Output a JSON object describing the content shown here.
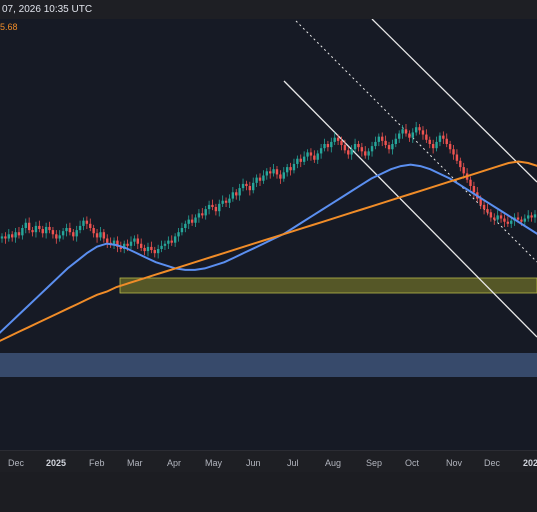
{
  "header": {
    "timestamp": "07, 2026 10:35 UTC"
  },
  "legend": {
    "ma_value": "5.68"
  },
  "chart_data": {
    "type": "candlestick",
    "x_tick_labels": [
      "Dec",
      "2025",
      "Feb",
      "Mar",
      "Apr",
      "May",
      "Jun",
      "Jul",
      "Aug",
      "Sep",
      "Oct",
      "Nov",
      "Dec",
      "202"
    ],
    "bold_ticks": [
      "2025",
      "202"
    ],
    "ohlc_close": [
      62,
      60,
      64,
      61,
      66,
      63,
      70,
      75,
      68,
      66,
      72,
      69,
      65,
      71,
      68,
      64,
      60,
      63,
      67,
      70,
      66,
      62,
      68,
      72,
      77,
      74,
      70,
      65,
      61,
      66,
      60,
      56,
      54,
      58,
      52,
      50,
      55,
      53,
      57,
      60,
      55,
      51,
      48,
      52,
      49,
      46,
      50,
      53,
      55,
      58,
      56,
      62,
      66,
      70,
      74,
      78,
      75,
      80,
      84,
      82,
      88,
      92,
      90,
      86,
      93,
      96,
      94,
      98,
      104,
      101,
      108,
      112,
      110,
      106,
      113,
      118,
      115,
      120,
      124,
      122,
      126,
      121,
      117,
      123,
      128,
      125,
      131,
      136,
      133,
      138,
      142,
      139,
      135,
      141,
      146,
      150,
      147,
      152,
      156,
      153,
      149,
      144,
      140,
      145,
      150,
      147,
      143,
      139,
      143,
      148,
      152,
      157,
      153,
      149,
      145,
      150,
      155,
      160,
      164,
      160,
      156,
      161,
      166,
      163,
      159,
      154,
      150,
      146,
      152,
      158,
      155,
      150,
      145,
      140,
      134,
      128,
      122,
      116,
      110,
      104,
      98,
      92,
      88,
      85,
      80,
      78,
      82,
      79,
      76,
      74,
      77,
      80,
      78,
      76,
      79,
      82,
      80,
      83
    ],
    "series": [
      {
        "name": "",
        "color": "#5b8ff0",
        "values": [
          10,
          16,
          22,
          28,
          34,
          40,
          46,
          52,
          57,
          62,
          66,
          68,
          67,
          65,
          62,
          59,
          56,
          54,
          52,
          51,
          51,
          52,
          54,
          56,
          59,
          62,
          65,
          68,
          71,
          74,
          78,
          82,
          86,
          90,
          94,
          98,
          102,
          106,
          110,
          113,
          116,
          118,
          119,
          118,
          116,
          113,
          110,
          106,
          102,
          98,
          94,
          90,
          86,
          82,
          78,
          74
        ]
      },
      {
        "name": "",
        "color": "#f08c28",
        "values": [
          5,
          8,
          11,
          14,
          17,
          20,
          23,
          26,
          29,
          32,
          35,
          37,
          40,
          42,
          44,
          46,
          48,
          50,
          52,
          54,
          56,
          58,
          60,
          62,
          64,
          66,
          68,
          70,
          72,
          74,
          76,
          78,
          80,
          82,
          84,
          86,
          88,
          90,
          92,
          94,
          96,
          98,
          100,
          102,
          104,
          106,
          108,
          110,
          112,
          114,
          116,
          118,
          120,
          121,
          120,
          118
        ]
      }
    ],
    "zones": [
      {
        "color": "#8a8a2a",
        "label": ""
      },
      {
        "color": "#3d5478",
        "label": ""
      }
    ]
  }
}
